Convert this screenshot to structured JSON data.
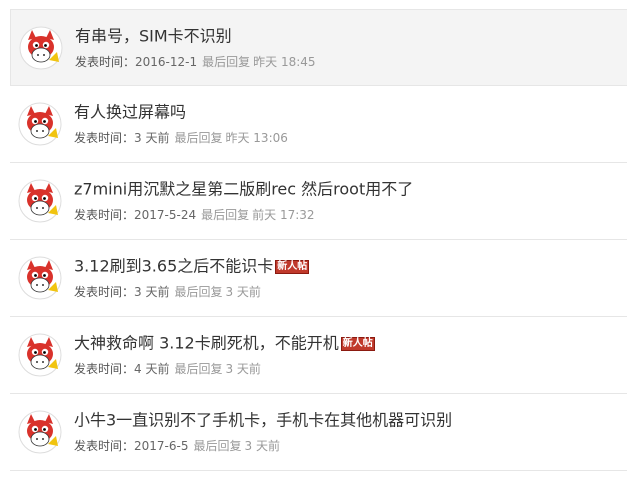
{
  "threads": [
    {
      "title": "有串号，SIM卡不识别",
      "post_label": "发表时间：",
      "post_time": "2016-12-1",
      "reply_label": "最后回复",
      "reply_time": "昨天 18:45",
      "badge": ""
    },
    {
      "title": "有人换过屏幕吗",
      "post_label": "发表时间：",
      "post_time": "3 天前",
      "reply_label": "最后回复",
      "reply_time": "昨天 13:06",
      "badge": ""
    },
    {
      "title": "z7mini用沉默之星第二版刷rec 然后root用不了",
      "post_label": "发表时间：",
      "post_time": "2017-5-24",
      "reply_label": "最后回复",
      "reply_time": "前天 17:32",
      "badge": ""
    },
    {
      "title": "3.12刷到3.65之后不能识卡",
      "post_label": "发表时间：",
      "post_time": "3 天前",
      "reply_label": "最后回复",
      "reply_time": "3 天前",
      "badge": "新人帖"
    },
    {
      "title": "大神救命啊 3.12卡刷死机，不能开机",
      "post_label": "发表时间：",
      "post_time": "4 天前",
      "reply_label": "最后回复",
      "reply_time": "3 天前",
      "badge": "新人帖"
    },
    {
      "title": "小牛3一直识别不了手机卡，手机卡在其他机器可识别",
      "post_label": "发表时间：",
      "post_time": "2017-6-5",
      "reply_label": "最后回复",
      "reply_time": "3 天前",
      "badge": ""
    }
  ],
  "colors": {
    "hover_bg": "#f4f4f4",
    "badge_bg": "#c0392b",
    "avatar_red": "#d9322b",
    "divider": "#e6e6e6"
  }
}
